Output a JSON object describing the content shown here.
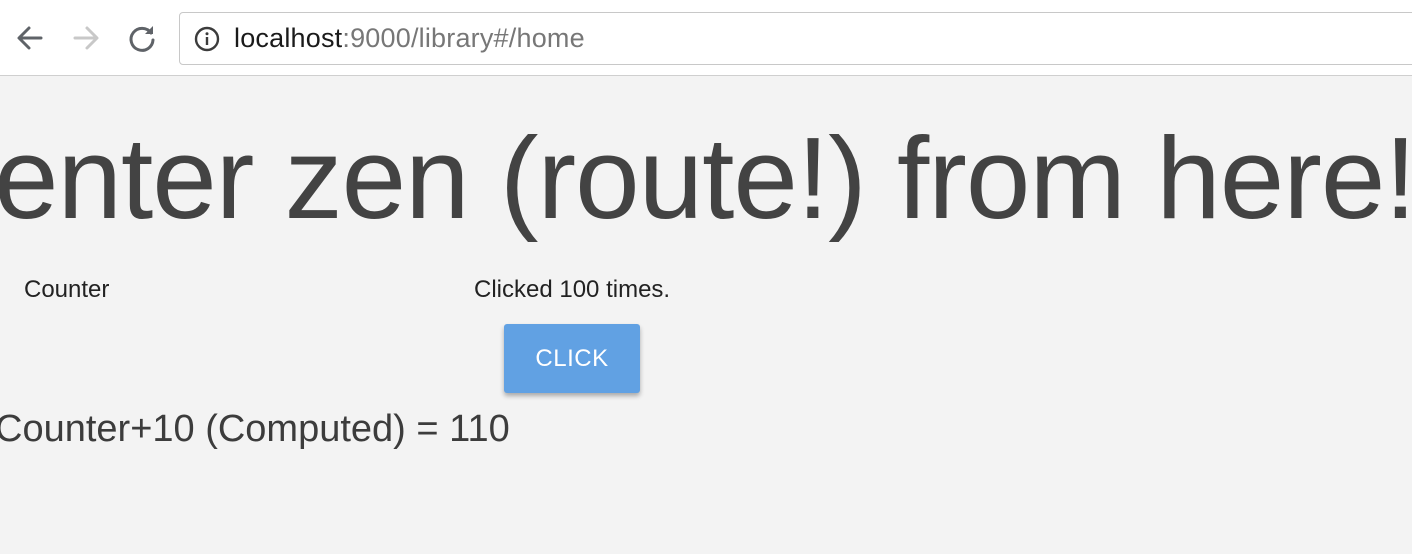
{
  "browser": {
    "url_host": "localhost",
    "url_rest": ":9000/library#/home",
    "back_icon": "arrow-left-icon",
    "forward_icon": "arrow-right-icon",
    "reload_icon": "reload-icon",
    "info_icon": "info-circle-icon"
  },
  "page": {
    "headline": "enter zen (route!) from here!",
    "counter_label": "Counter",
    "counter_status": "Clicked 100 times.",
    "click_button_label": "CLICK",
    "computed_text": "Counter+10 (Computed) = 110"
  },
  "colors": {
    "background": "#f3f3f3",
    "button": "#61a1e3",
    "headline_text": "#434343"
  }
}
